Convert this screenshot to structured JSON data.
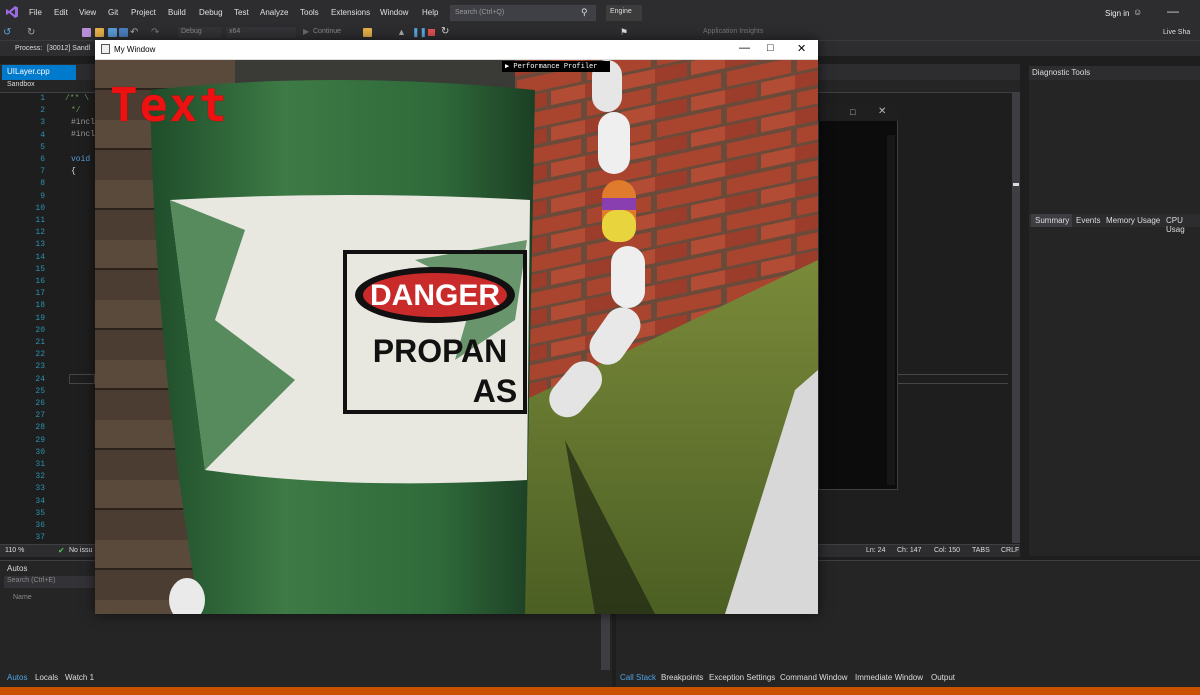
{
  "menubar": {
    "items": [
      "File",
      "Edit",
      "View",
      "Git",
      "Project",
      "Build",
      "Debug",
      "Test",
      "Analyze",
      "Tools",
      "Extensions",
      "Window",
      "Help"
    ],
    "search_placeholder": "Search (Ctrl+Q)",
    "solution_name": "Engine",
    "sign_in": "Sign in",
    "live_share": "Live Sha"
  },
  "toolbar": {
    "config": "Debug",
    "platform": "x64",
    "continue": "Continue",
    "app_insights": "Application Insights"
  },
  "process": {
    "label": "Process:",
    "value": "[30012] Sandl"
  },
  "editor": {
    "tab": "UILayer.cpp",
    "project": "Sandbox",
    "line_numbers": [
      "1",
      "2",
      "3",
      "4",
      "5",
      "6",
      "7",
      "8",
      "9",
      "10",
      "11",
      "12",
      "13",
      "14",
      "15",
      "16",
      "17",
      "18",
      "19",
      "20",
      "21",
      "22",
      "23",
      "24",
      "25",
      "26",
      "27",
      "28",
      "29",
      "30",
      "31",
      "32",
      "33",
      "34",
      "35",
      "36",
      "37"
    ],
    "code": {
      "l1": "/** \\",
      "l2": "*/",
      "l3": "#incl",
      "l4": "#incl",
      "l6": "void",
      "l7": "{"
    },
    "zoom": "110 %",
    "issues": "No issu",
    "ln": "Ln: 24",
    "ch": "Ch: 147",
    "col": "Col: 150",
    "tabs": "TABS",
    "crlf": "CRLF"
  },
  "diagnostic": {
    "title": "Diagnostic Tools",
    "tabs": [
      "Summary",
      "Events",
      "Memory Usage",
      "CPU Usag"
    ]
  },
  "autos": {
    "title": "Autos",
    "search_placeholder": "Search (Ctrl+E)",
    "col_name": "Name",
    "tabs": [
      "Autos",
      "Locals",
      "Watch 1"
    ]
  },
  "callstack": {
    "tabs": [
      "Call Stack",
      "Breakpoints",
      "Exception Settings",
      "Command Window",
      "Immediate Window",
      "Output"
    ]
  },
  "gamewindow": {
    "title": "My Window",
    "profiler": "Performance Profiler",
    "overlay_text": "Text",
    "sign_text_1": "DANGER",
    "sign_text_2": "PROPAN",
    "sign_text_3": "AS"
  },
  "colors": {
    "accent": "#007acc",
    "statusbar": "#ca5100",
    "overlay_text": "#e11111"
  }
}
